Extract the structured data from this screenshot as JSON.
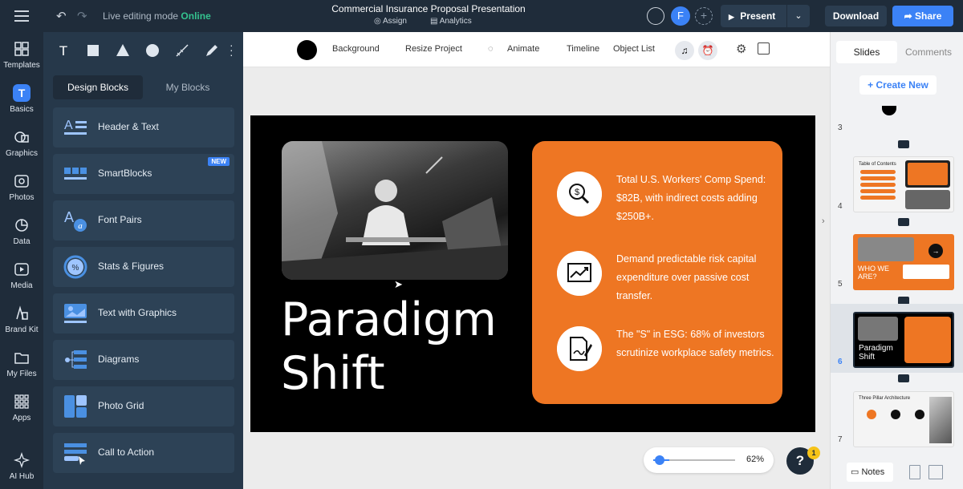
{
  "topbar": {
    "mode_text": "Live editing mode",
    "mode_status": "Online",
    "project_title": "Commercial Insurance Proposal Presentation",
    "assign": "Assign",
    "analytics": "Analytics",
    "avatar_initial": "F",
    "present": "Present",
    "download": "Download",
    "share": "Share"
  },
  "leftnav": [
    "Templates",
    "Basics",
    "Graphics",
    "Photos",
    "Data",
    "Media",
    "Brand Kit",
    "My Files",
    "Apps",
    "AI Hub"
  ],
  "panel": {
    "tab_design": "Design Blocks",
    "tab_my": "My Blocks",
    "new_badge": "NEW",
    "blocks": [
      "Header & Text",
      "SmartBlocks",
      "Font Pairs",
      "Stats & Figures",
      "Text with Graphics",
      "Diagrams",
      "Photo Grid",
      "Call to Action"
    ]
  },
  "toolbar": {
    "background": "Background",
    "resize": "Resize Project",
    "animate": "Animate",
    "timeline": "Timeline",
    "object_list": "Object List"
  },
  "slide": {
    "title_line1": "Paradigm",
    "title_line2": "Shift",
    "points": [
      "Total U.S. Workers' Comp Spend: $82B, with indirect costs adding $250B+.",
      "Demand predictable risk capital expenditure over passive cost transfer.",
      "The \"S\" in ESG: 68% of investors scrutinize workplace safety metrics."
    ],
    "icons": [
      "search-dollar-icon",
      "trending-chart-icon",
      "signed-document-icon"
    ],
    "accent": "#ee7623"
  },
  "zoom": {
    "value": "62%",
    "level": 0.62
  },
  "help": {
    "label": "?",
    "badge": "1"
  },
  "rightpanel": {
    "tab_slides": "Slides",
    "tab_comments": "Comments",
    "create_new": "+ Create New",
    "slides": [
      {
        "num": "3"
      },
      {
        "num": "4",
        "title": "Table of Contents"
      },
      {
        "num": "5",
        "title": "WHO WE ARE?"
      },
      {
        "num": "6",
        "title": "Paradigm Shift"
      },
      {
        "num": "7",
        "title": "Three Pillar Architecture"
      }
    ],
    "notes": "Notes"
  },
  "colors": {
    "dark": "#1f2c3a",
    "panel": "#26384a",
    "blue": "#3b82f6",
    "orange": "#ee7623",
    "online": "#34c38f"
  }
}
